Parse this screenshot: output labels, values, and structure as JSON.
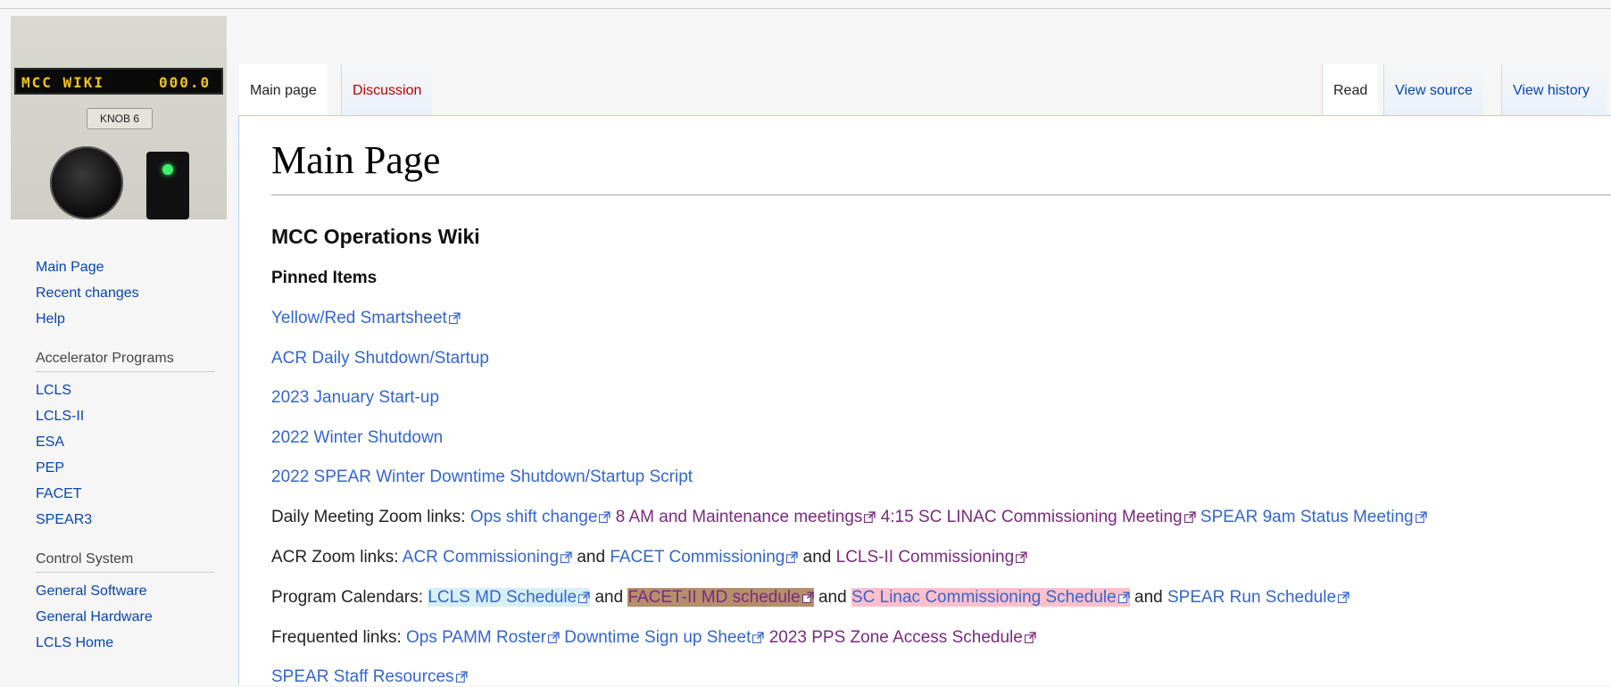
{
  "logo": {
    "lcd_left": "MCC WIKI",
    "lcd_right": "000.0",
    "knob_label": "KNOB 6"
  },
  "sidebar": {
    "navigation": [
      "Main Page",
      "Recent changes",
      "Help"
    ],
    "sections": [
      {
        "heading": "Accelerator Programs",
        "items": [
          "LCLS",
          "LCLS-II",
          "ESA",
          "PEP",
          "FACET",
          "SPEAR3"
        ]
      },
      {
        "heading": "Control System",
        "items": [
          "General Software",
          "General Hardware",
          "LCLS Home"
        ]
      }
    ]
  },
  "tabs": {
    "left": [
      "Main page",
      "Discussion"
    ],
    "right": [
      "Read",
      "View source",
      "View history"
    ]
  },
  "page": {
    "title": "Main Page",
    "subtitle": "MCC Operations Wiki",
    "pinned_heading": "Pinned Items",
    "pinned_links": [
      "Yellow/Red Smartsheet",
      "ACR Daily Shutdown/Startup",
      "2023 January Start-up",
      "2022 Winter Shutdown",
      "2022 SPEAR Winter Downtime Shutdown/Startup Script"
    ],
    "daily_meeting": {
      "label": "Daily Meeting Zoom links:",
      "links": [
        "Ops shift change",
        "8 AM and Maintenance meetings",
        "4:15 SC LINAC Commissioning Meeting",
        "SPEAR 9am Status Meeting"
      ]
    },
    "acr_zoom": {
      "label": "ACR Zoom links:",
      "links": [
        "ACR Commissioning",
        "FACET Commissioning",
        "LCLS-II Commissioning"
      ],
      "and": "and"
    },
    "calendars": {
      "label": "Program Calendars:",
      "links": [
        "LCLS MD Schedule",
        "FACET-II MD schedule",
        "SC Linac Commissioning Schedule",
        "SPEAR Run Schedule"
      ],
      "and": "and"
    },
    "frequented": {
      "label": "Frequented links:",
      "links": [
        "Ops PAMM Roster",
        "Downtime Sign up Sheet",
        "2023 PPS Zone Access Schedule"
      ]
    },
    "spear_staff": "SPEAR Staff Resources"
  },
  "colors": {
    "link": "#3366cc",
    "visited": "#7a2a7f",
    "highlight_blue": "#d8f0f5",
    "highlight_brown": "#b58e6c",
    "highlight_pink": "#ffc0cb"
  }
}
